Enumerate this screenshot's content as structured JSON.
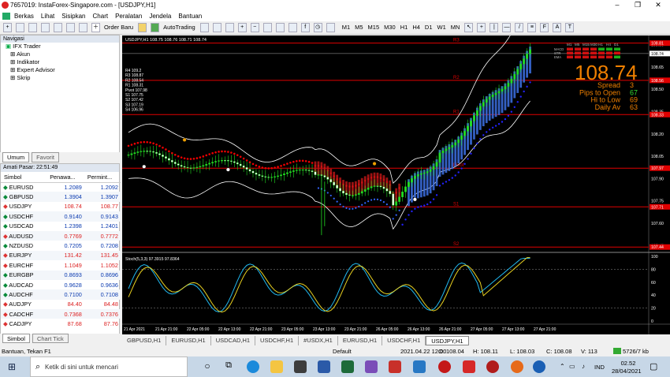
{
  "window": {
    "title": "7657019: InstaForex-Singapore.com - [USDJPY,H1]",
    "min": "–",
    "restore": "❐",
    "close": "✕"
  },
  "menu": [
    "Berkas",
    "Lihat",
    "Sisipkan",
    "Chart",
    "Peralatan",
    "Jendela",
    "Bantuan"
  ],
  "toolbar": {
    "order_label": "Order Baru",
    "auto_label": "AutoTrading",
    "timeframes": [
      "M1",
      "M5",
      "M15",
      "M30",
      "H1",
      "H4",
      "D1",
      "W1",
      "MN"
    ]
  },
  "navigator": {
    "title": "Navigasi",
    "items": [
      "IFX Trader",
      "Akun",
      "Indikator",
      "Expert Advisor",
      "Skrip"
    ],
    "tabs": [
      "Umum",
      "Favorit"
    ]
  },
  "market": {
    "title": "Amati Pasar: 22:51:49",
    "headers": [
      "Simbol",
      "Penawa...",
      "Permint..."
    ],
    "rows": [
      {
        "s": "EURUSD",
        "b": "1.2089",
        "a": "1.2092",
        "up": true
      },
      {
        "s": "GBPUSD",
        "b": "1.3904",
        "a": "1.3907",
        "up": true
      },
      {
        "s": "USDJPY",
        "b": "108.74",
        "a": "108.77",
        "up": false
      },
      {
        "s": "USDCHF",
        "b": "0.9140",
        "a": "0.9143",
        "up": true
      },
      {
        "s": "USDCAD",
        "b": "1.2398",
        "a": "1.2401",
        "up": true
      },
      {
        "s": "AUDUSD",
        "b": "0.7769",
        "a": "0.7772",
        "up": false
      },
      {
        "s": "NZDUSD",
        "b": "0.7205",
        "a": "0.7208",
        "up": true
      },
      {
        "s": "EURJPY",
        "b": "131.42",
        "a": "131.45",
        "up": false
      },
      {
        "s": "EURCHF",
        "b": "1.1049",
        "a": "1.1052",
        "up": false
      },
      {
        "s": "EURGBP",
        "b": "0.8693",
        "a": "0.8696",
        "up": true
      },
      {
        "s": "AUDCAD",
        "b": "0.9628",
        "a": "0.9636",
        "up": true
      },
      {
        "s": "AUDCHF",
        "b": "0.7100",
        "a": "0.7108",
        "up": true
      },
      {
        "s": "AUDJPY",
        "b": "84.40",
        "a": "84.48",
        "up": false
      },
      {
        "s": "CADCHF",
        "b": "0.7368",
        "a": "0.7376",
        "up": false
      },
      {
        "s": "CADJPY",
        "b": "87.68",
        "a": "87.76",
        "up": false
      }
    ],
    "tabs": [
      "Simbol",
      "Chart Tick"
    ]
  },
  "chart": {
    "header": "USDJPY,H1  108.75 108.76 108.71 108.74",
    "pivots": [
      "R4 109.2",
      "R3 108.87",
      "R2 108.54",
      "R1 108.31",
      "Pivot 107.98",
      "S1 107.75",
      "S2 107.42",
      "S3 107.19",
      "S4 106.96"
    ],
    "level_labels": [
      "R3",
      "R2",
      "R1",
      "Pivot",
      "S1",
      "S2"
    ],
    "big_price": "108.74",
    "info": [
      {
        "label": "Spread",
        "value": "3",
        "color": "#f08000"
      },
      {
        "label": "Pips to Open",
        "value": "67",
        "color": "#33dd33"
      },
      {
        "label": "Hi to Low",
        "value": "69",
        "color": "#f08000"
      },
      {
        "label": "Daily Av",
        "value": "63",
        "color": "#f08000"
      }
    ],
    "mtf_headers": [
      "M1",
      "M5",
      "M15",
      "M30",
      "H1",
      "H4",
      "D1"
    ],
    "mtf_rows": [
      "MACD",
      "STR",
      "EMA"
    ],
    "price_axis": [
      "108.80",
      "108.65",
      "108.50",
      "108.35",
      "108.20",
      "108.05",
      "107.90",
      "107.75",
      "107.60",
      "107.45"
    ],
    "price_tags": [
      {
        "v": "108.81",
        "c": "#e00000"
      },
      {
        "v": "108.74",
        "c": "#ffffff"
      },
      {
        "v": "108.56",
        "c": "#e00000"
      },
      {
        "v": "108.33",
        "c": "#e00000"
      },
      {
        "v": "107.97",
        "c": "#e00000"
      },
      {
        "v": "107.71",
        "c": "#e00000"
      },
      {
        "v": "107.44",
        "c": "#e00000"
      }
    ],
    "stoch_label": "Stoch(5,3,3) 97.3915 97.8364",
    "stoch_axis": [
      "100",
      "80",
      "60",
      "40",
      "20",
      "0"
    ],
    "time_axis": [
      "21 Apr 2021",
      "21 Apr 21:00",
      "22 Apr 05:00",
      "22 Apr 13:00",
      "22 Apr 21:00",
      "23 Apr 05:00",
      "23 Apr 13:00",
      "23 Apr 21:00",
      "26 Apr 05:00",
      "26 Apr 13:00",
      "26 Apr 21:00",
      "27 Apr 05:00",
      "27 Apr 13:00",
      "27 Apr 21:00"
    ]
  },
  "chart_tabs": [
    "GBPUSD,H1",
    "EURUSD,H1",
    "USDCAD,H1",
    "USDCHF,H1",
    "#USDX,H1",
    "EURUSD,H1",
    "USDCHF,H1",
    "USDJPY,H1"
  ],
  "status": {
    "help": "Bantuan, Tekan F1",
    "profile": "Default",
    "time": "2021.04.22 12:00",
    "o": "O: 108.04",
    "h": "H: 108.11",
    "l": "L: 108.03",
    "c": "C: 108.08",
    "v": "V: 113",
    "traffic": "5726/7 kb"
  },
  "taskbar": {
    "search": "Ketik di sini untuk mencari",
    "time": "02.52",
    "date": "28/04/2021",
    "lang": "IND"
  }
}
